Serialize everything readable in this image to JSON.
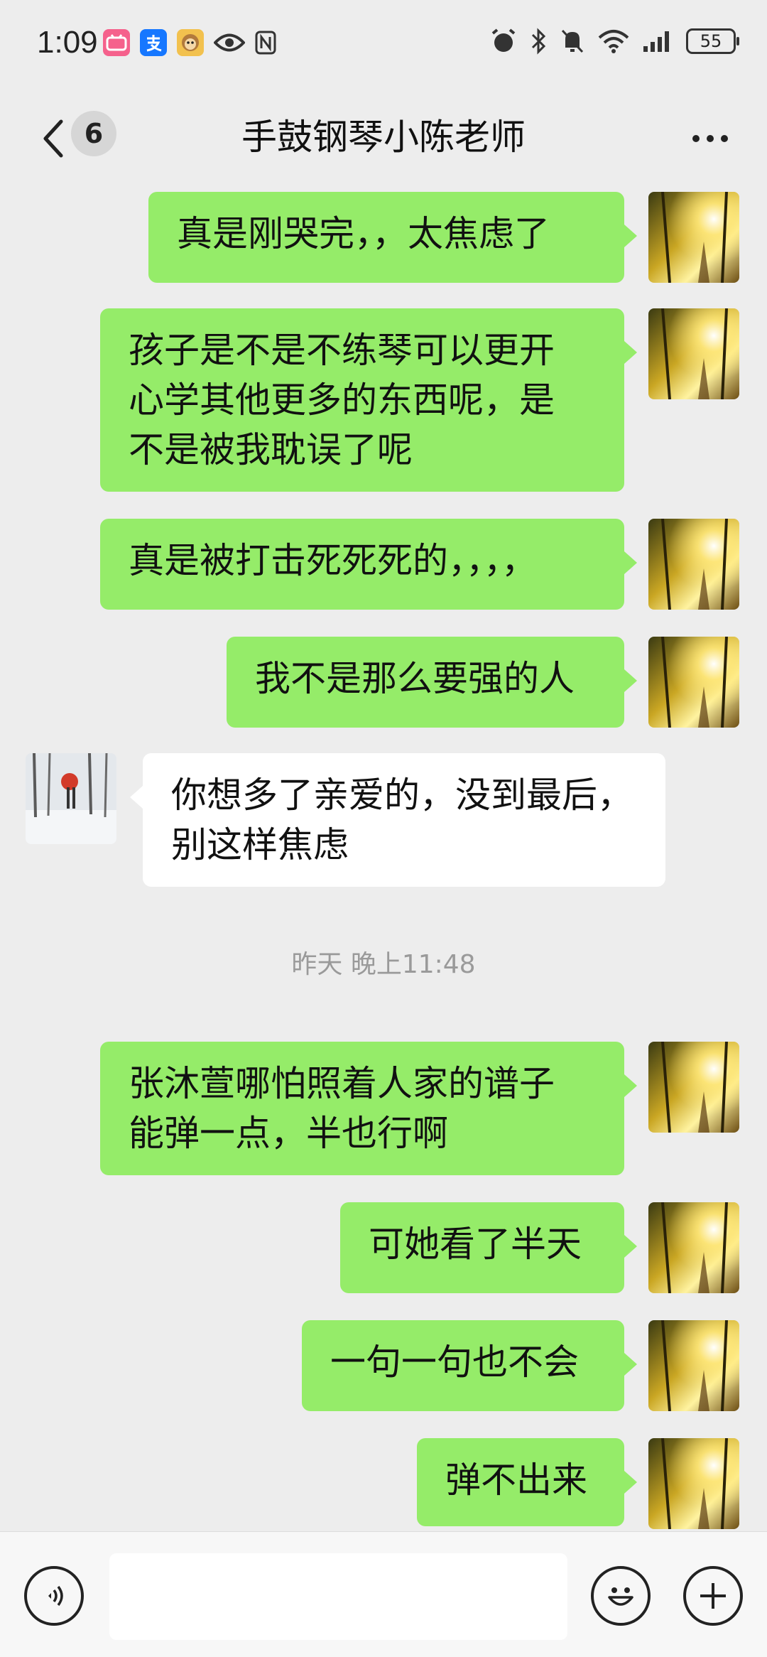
{
  "status_bar": {
    "time": "1:09",
    "battery": "55",
    "left_icons": [
      "bilibili-icon",
      "alipay-icon",
      "monkey-app-icon",
      "eye-icon",
      "nfc-icon"
    ],
    "right_icons": [
      "alarm-icon",
      "bluetooth-icon",
      "mute-icon",
      "wifi-icon",
      "signal-icon",
      "battery-icon"
    ]
  },
  "header": {
    "unread_count": "6",
    "title": "手鼓钢琴小陈老师"
  },
  "messages": [
    {
      "side": "out",
      "text": "真是刚哭完，，太焦虑了"
    },
    {
      "side": "out",
      "text": "孩子是不是不练琴可以更开\n心学其他更多的东西呢，是\n不是被我耽误了呢"
    },
    {
      "side": "out",
      "text": "真是被打击死死死的，，，，"
    },
    {
      "side": "out",
      "text": "我不是那么要强的人"
    },
    {
      "side": "in",
      "text": "你想多了亲爱的，没到最后，\n别这样焦虑"
    },
    {
      "side": "out",
      "text": "张沐萱哪怕照着人家的谱子\n能弹一点，半也行啊"
    },
    {
      "side": "out",
      "text": "可她看了半天"
    },
    {
      "side": "out",
      "text": "一句一句也不会"
    },
    {
      "side": "out",
      "text": "弹不出来"
    }
  ],
  "timestamp": "昨天 晚上11:48",
  "input_bar": {
    "text_value": ""
  },
  "colors": {
    "outgoing_bubble": "#95ec69",
    "incoming_bubble": "#ffffff",
    "background": "#ededed"
  }
}
